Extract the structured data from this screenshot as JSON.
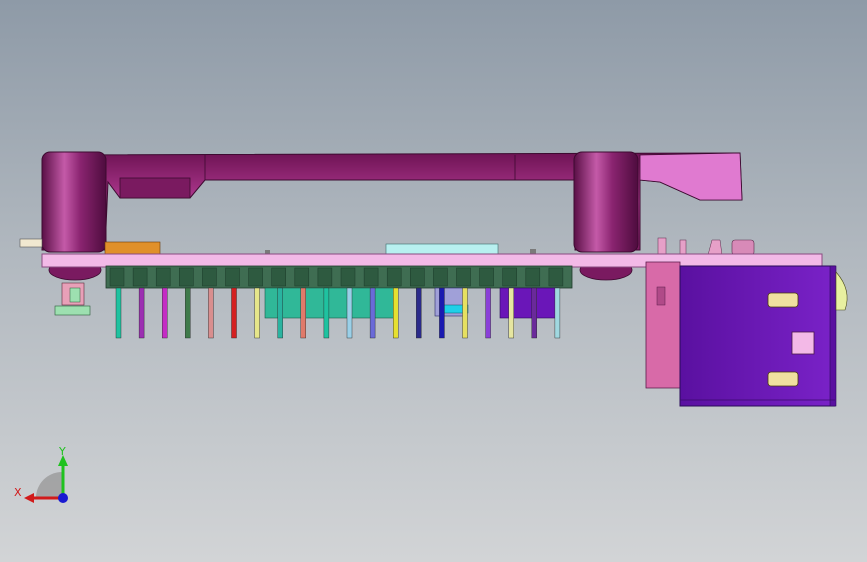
{
  "view": {
    "background_top": "#8e9aa7",
    "background_bottom": "#d2d4d6"
  },
  "colors": {
    "bracket": "#8a1f6b",
    "bracket_light": "#c44aa0",
    "pcb": "#f3b9e7",
    "pcb_edge": "#b56aa8",
    "header": "#3f6d52",
    "usb_body": "#6a16b8",
    "usb_shell": "#c45a9a",
    "pin_colors": [
      "#1fc2a0",
      "#9c2fb2",
      "#c42cc4",
      "#3f7a4a",
      "#d98e8e",
      "#d42020",
      "#e6e68a",
      "#2ab3a0",
      "#e07a6a",
      "#1fc2a0",
      "#9ad0e8",
      "#6a6ad8",
      "#e6e030",
      "#2a2a8a",
      "#1a1ab0",
      "#e6e060",
      "#8a3fd8",
      "#e6e6a0",
      "#6a2a9a",
      "#a0d8e0"
    ]
  },
  "triad": {
    "x_label": "X",
    "y_label": "Y",
    "x_color": "#d11a1a",
    "y_color": "#1fc21f",
    "z_color": "#1a1ad1",
    "icon": "coordinate-triad-icon"
  }
}
